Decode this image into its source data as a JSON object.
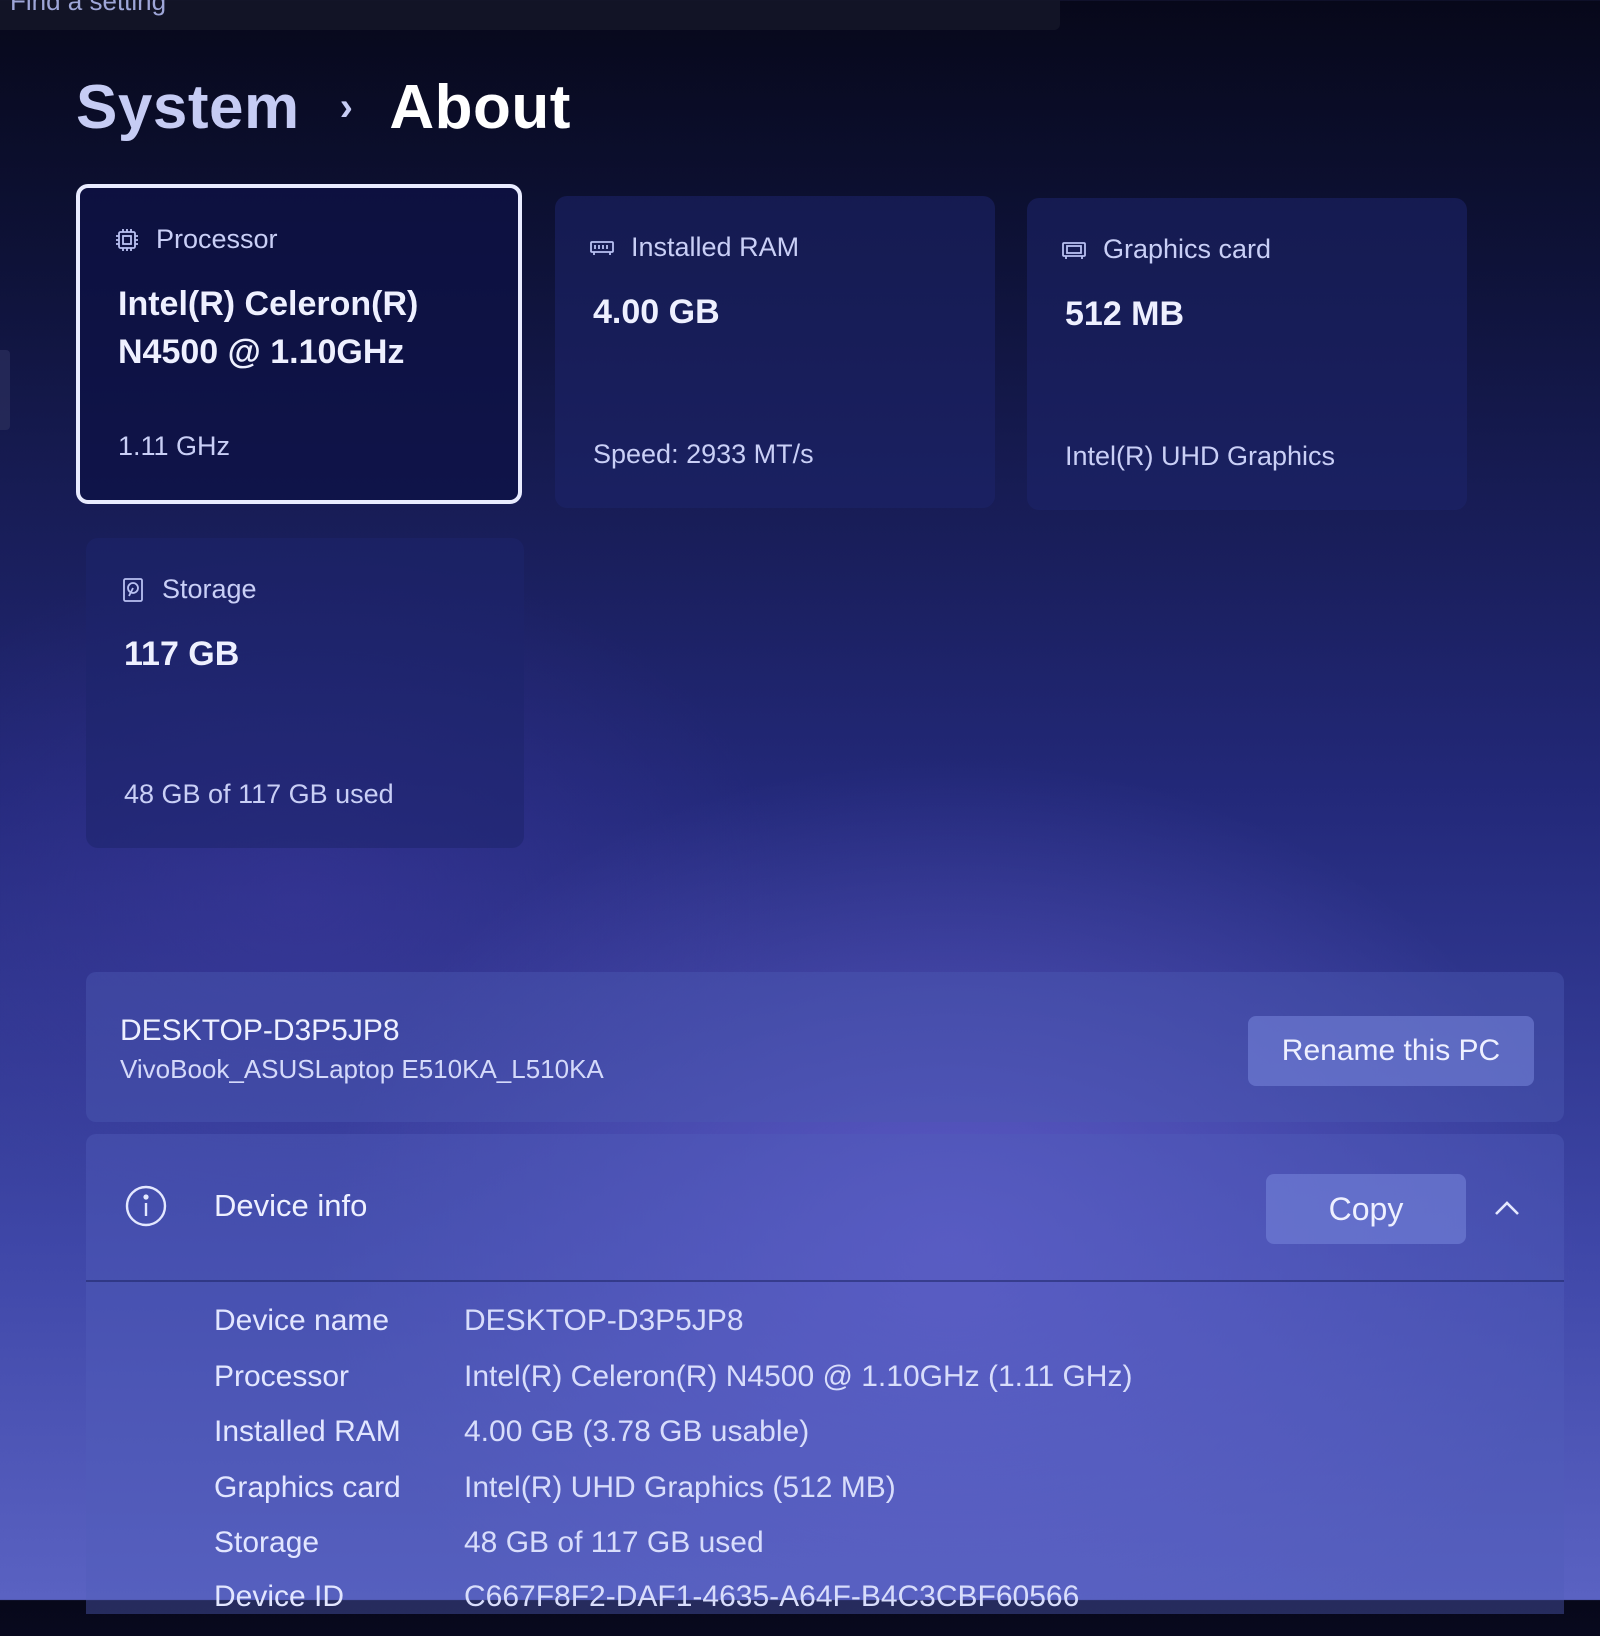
{
  "search": {
    "text": "Find a setting"
  },
  "breadcrumb": {
    "parent": "System",
    "separator": "›",
    "current": "About"
  },
  "cards": {
    "processor": {
      "label": "Processor",
      "icon": "processor-icon",
      "value": "Intel(R) Celeron(R)\nN4500 @ 1.10GHz",
      "sub": "1.11 GHz"
    },
    "ram": {
      "label": "Installed RAM",
      "icon": "ram-icon",
      "value": "4.00 GB",
      "sub": "Speed: 2933 MT/s"
    },
    "graphics": {
      "label": "Graphics card",
      "icon": "graphics-card-icon",
      "value": "512 MB",
      "sub": "Intel(R) UHD Graphics"
    },
    "storage": {
      "label": "Storage",
      "icon": "storage-icon",
      "value": "117 GB",
      "sub": "48 GB of 117 GB used"
    }
  },
  "rename": {
    "pc_name": "DESKTOP-D3P5JP8",
    "model": "VivoBook_ASUSLaptop E510KA_L510KA",
    "button_label": "Rename this PC"
  },
  "device_info": {
    "title": "Device info",
    "copy_label": "Copy",
    "rows": [
      {
        "key": "Device name",
        "value": "DESKTOP-D3P5JP8"
      },
      {
        "key": "Processor",
        "value": "Intel(R) Celeron(R) N4500 @ 1.10GHz (1.11 GHz)"
      },
      {
        "key": "Installed RAM",
        "value": "4.00 GB (3.78 GB usable)"
      },
      {
        "key": "Graphics card",
        "value": "Intel(R) UHD Graphics (512 MB)"
      },
      {
        "key": "Storage",
        "value": "48 GB of 117 GB used"
      },
      {
        "key": "Device ID",
        "value": "C667F8F2-DAF1-4635-A64F-B4C3CBF60566"
      }
    ]
  },
  "colors": {
    "accent": "#e9ecff",
    "card": "#1e246c",
    "panel": "#505cba"
  }
}
